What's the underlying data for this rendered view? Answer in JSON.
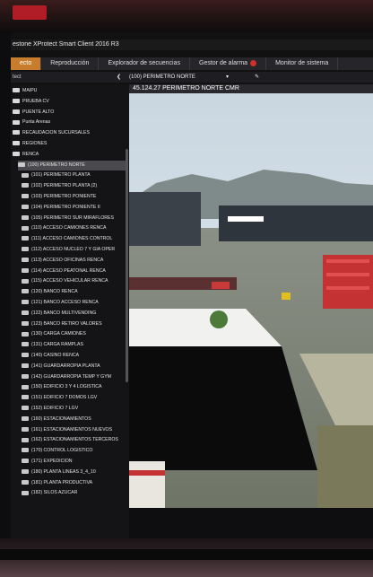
{
  "app": {
    "title": "estone XProtect Smart Client 2016 R3"
  },
  "tabs": [
    {
      "label": "ecto",
      "active": true
    },
    {
      "label": "Reproducción"
    },
    {
      "label": "Explorador de secuencias"
    },
    {
      "label": "Gestor de alarma",
      "badge": true
    },
    {
      "label": "Monitor de sistema"
    }
  ],
  "toolbar": {
    "left_label": "tect",
    "view_label": "(100) PERIMETRO NORTE",
    "dropdown_icon": "chevron-down-icon",
    "back_icon": "chevron-left-icon"
  },
  "camera": {
    "title": "45.124.27 PERIMETRO NORTE CMR"
  },
  "tree": [
    {
      "label": "MAIPU",
      "type": "folder"
    },
    {
      "label": "PRUEBA CV",
      "type": "folder"
    },
    {
      "label": "PUENTE ALTO",
      "type": "folder"
    },
    {
      "label": "Punta Arenas",
      "type": "folder"
    },
    {
      "label": "RECAUDACION SUCURSALES",
      "type": "folder"
    },
    {
      "label": "REGIONES",
      "type": "folder"
    },
    {
      "label": "RENCA",
      "type": "folder"
    },
    {
      "label": "(100) PERIMETRO NORTE",
      "type": "camera",
      "selected": true
    },
    {
      "label": "(101) PERIMETRO PLANTA",
      "type": "camera"
    },
    {
      "label": "(102) PERIMETRO PLANTA (2)",
      "type": "camera"
    },
    {
      "label": "(103) PERIMETRO PONIENTE",
      "type": "camera"
    },
    {
      "label": "(104) PERIMETRO PONIENTE II",
      "type": "camera"
    },
    {
      "label": "(105) PERIMETRO SUR MIRAFLORES",
      "type": "camera"
    },
    {
      "label": "(110) ACCESO CAMIONES RENCA",
      "type": "camera"
    },
    {
      "label": "(111) ACCESO CAMIONES CONTROL",
      "type": "camera"
    },
    {
      "label": "(112) ACCESO NUCLEO 7 Y GIA OPER",
      "type": "camera"
    },
    {
      "label": "(113) ACCESO OFICINAS RENCA",
      "type": "camera"
    },
    {
      "label": "(114) ACCESO PEATONAL RENCA",
      "type": "camera"
    },
    {
      "label": "(115) ACCESO VEHICULAR RENCA",
      "type": "camera"
    },
    {
      "label": "(120) BANCO RENCA",
      "type": "camera"
    },
    {
      "label": "(121) BANCO ACCESO RENCA",
      "type": "camera"
    },
    {
      "label": "(122) BANCO MULTIVENDING",
      "type": "camera"
    },
    {
      "label": "(123) BANCO RETIRO VALORES",
      "type": "camera"
    },
    {
      "label": "(130) CARGA CAMIONES",
      "type": "camera"
    },
    {
      "label": "(131) CARGA RAMPLAS",
      "type": "camera"
    },
    {
      "label": "(140) CASINO RENCA",
      "type": "camera"
    },
    {
      "label": "(141) GUARDARROPIA PLANTA",
      "type": "camera"
    },
    {
      "label": "(142) GUARDARROPIA TEMP Y GYM",
      "type": "camera"
    },
    {
      "label": "(150) EDIFICIO 3 Y 4 LOGISTICA",
      "type": "camera"
    },
    {
      "label": "(151) EDIFICIO 7 DOMOS LGV",
      "type": "camera"
    },
    {
      "label": "(152) EDIFICIO 7 LGV",
      "type": "camera"
    },
    {
      "label": "(160) ESTACIONAMIENTOS",
      "type": "camera"
    },
    {
      "label": "(161) ESTACIONAMIENTOS NUEVOS",
      "type": "camera"
    },
    {
      "label": "(162) ESTACIONAMIENTOS TERCEROS",
      "type": "camera"
    },
    {
      "label": "(170) CONTROL LOGISTICO",
      "type": "camera"
    },
    {
      "label": "(171) EXPEDICION",
      "type": "camera"
    },
    {
      "label": "(180) PLANTA LINEAS 3_4_10",
      "type": "camera"
    },
    {
      "label": "(181) PLANTA PRODUCTIVA",
      "type": "camera"
    },
    {
      "label": "(182) SILOS AZUCAR",
      "type": "camera"
    }
  ]
}
